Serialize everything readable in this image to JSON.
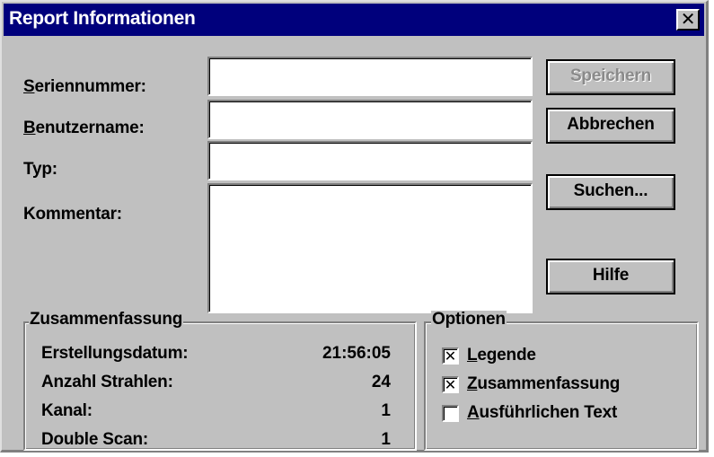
{
  "window": {
    "title": "Report Informationen",
    "close_glyph": "✕"
  },
  "fields": {
    "seriennummer": {
      "label_key": "S",
      "label_rest": "eriennummer:",
      "value": ""
    },
    "benutzername": {
      "label_key": "B",
      "label_rest": "enutzername:",
      "value": ""
    },
    "typ": {
      "label": "Typ:",
      "value": ""
    },
    "kommentar": {
      "label": "Kommentar:",
      "value": ""
    }
  },
  "buttons": {
    "speichern": "Speichern",
    "abbrechen": "Abbrechen",
    "suchen": "Suchen...",
    "hilfe": "Hilfe"
  },
  "summary": {
    "title": "Zusammenfassung",
    "rows": [
      {
        "label": "Erstellungsdatum:",
        "value": "21:56:05"
      },
      {
        "label": "Anzahl Strahlen:",
        "value": "24"
      },
      {
        "label": "Kanal:",
        "value": "1"
      },
      {
        "label": "Double Scan:",
        "value": "1"
      }
    ]
  },
  "options": {
    "title": "Optionen",
    "items": [
      {
        "key": "L",
        "rest": "egende",
        "checked": true,
        "mark": "✕"
      },
      {
        "key": "Z",
        "rest": "usammenfassung",
        "checked": true,
        "mark": "✕"
      },
      {
        "key": "A",
        "rest": "usführlichen Text",
        "checked": false,
        "mark": ""
      }
    ]
  },
  "colors": {
    "titlebar": "#00007c",
    "face": "#c0c0c0",
    "disabled_text": "#8a8a8a"
  }
}
